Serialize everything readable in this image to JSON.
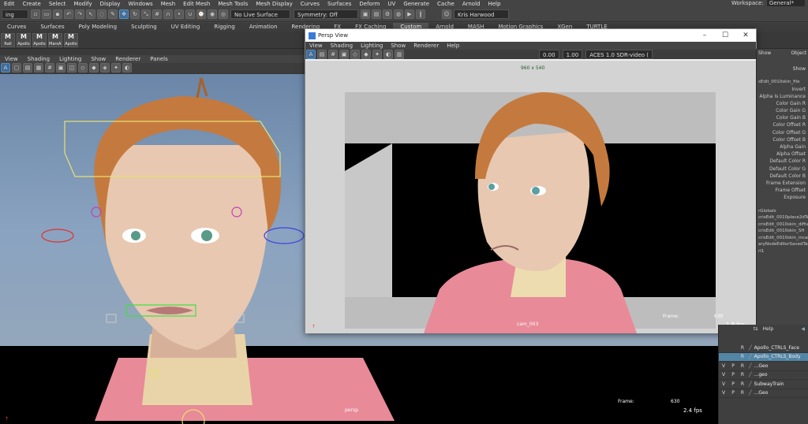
{
  "menubar": {
    "items": [
      "Edit",
      "Create",
      "Select",
      "Modify",
      "Display",
      "Windows",
      "Mesh",
      "Edit Mesh",
      "Mesh Tools",
      "Mesh Display",
      "Curves",
      "Surfaces",
      "Deform",
      "UV",
      "Generate",
      "Cache",
      "Arnold",
      "Help"
    ],
    "workspace_label": "Workspace:",
    "workspace_value": "General*"
  },
  "statusline": {
    "mode": "ing",
    "live_surface": "No Live Surface",
    "symmetry": "Symmetry: Off",
    "user": "Kris Harwood"
  },
  "shelf_tabs": [
    "Curves",
    "Surfaces",
    "Poly Modeling",
    "Sculpting",
    "UV Editing",
    "Rigging",
    "Animation",
    "Rendering",
    "FX",
    "FX Caching",
    "Custom",
    "Arnold",
    "MASH",
    "Motion Graphics",
    "XGen",
    "TURTLE"
  ],
  "shelf_tabs_active": 10,
  "shelf_buttons": [
    "Rall",
    "Apollo",
    "Apollo",
    "MarsAl",
    "Apollo"
  ],
  "main_panel": {
    "menu": [
      "View",
      "Shading",
      "Lighting",
      "Show",
      "Renderer",
      "Panels"
    ],
    "camera_label": "persp",
    "frame_label": "Frame:",
    "frame_value": "630",
    "fps": "2.4 fps"
  },
  "persp_window": {
    "title": "Persp View",
    "menu": [
      "View",
      "Shading",
      "Lighting",
      "Show",
      "Renderer",
      "Help"
    ],
    "resolution": "960 x 540",
    "camera_label": "cam_003",
    "frame_label": "Frame:",
    "frame_value": "630",
    "fps": "1.8 fps",
    "field_a": "0.00",
    "field_b": "1.00",
    "color_space": "ACES 1.0 SDR-video ("
  },
  "right_panel": {
    "tabs": [
      "Show",
      "Object",
      "Show"
    ],
    "node_name": "sEdit_0010skin_file",
    "attributes": [
      "Invert",
      "Alpha Is Luminance",
      "Color Gain R",
      "Color Gain G",
      "Color Gain B",
      "Color Offset R",
      "Color Offset G",
      "Color Offset B",
      "Alpha Gain",
      "Alpha Offset",
      "Default Color R",
      "Default Color G",
      "Default Color B",
      "Frame Extension",
      "Frame Offset",
      "Exposure"
    ],
    "nodes": [
      "rGlobals",
      "crisEdit_0010place2dTex",
      "crisEdit_0010skin_diffu",
      "crisEdit_0010skin_SH",
      "crisEdit_0010skin_incan",
      "aryNodeEditorSavedTab",
      "rl1"
    ]
  },
  "layer_panel": {
    "menu": [
      "ts",
      "Help"
    ],
    "layers": [
      {
        "v": "",
        "p": "",
        "r": "R",
        "name": "Apollo_CTRLS_Face",
        "selected": false
      },
      {
        "v": "",
        "p": "",
        "r": "R",
        "name": "Apollo_CTRLS_Body",
        "selected": true
      },
      {
        "v": "V",
        "p": "P",
        "r": "R",
        "name": "...Geo",
        "selected": false
      },
      {
        "v": "V",
        "p": "P",
        "r": "R",
        "name": "...geo",
        "selected": false
      },
      {
        "v": "V",
        "p": "P",
        "r": "R",
        "name": "SubwayTrain",
        "selected": false
      },
      {
        "v": "V",
        "p": "P",
        "r": "R",
        "name": "...Geo",
        "selected": false
      }
    ]
  },
  "colors": {
    "viewport_bg": "#7f98b6",
    "selection": "#5285a6",
    "hair": "#c47a3e",
    "skin": "#e8c8b0",
    "jacket": "#e88a98",
    "curve_yellow": "#e8e070"
  }
}
